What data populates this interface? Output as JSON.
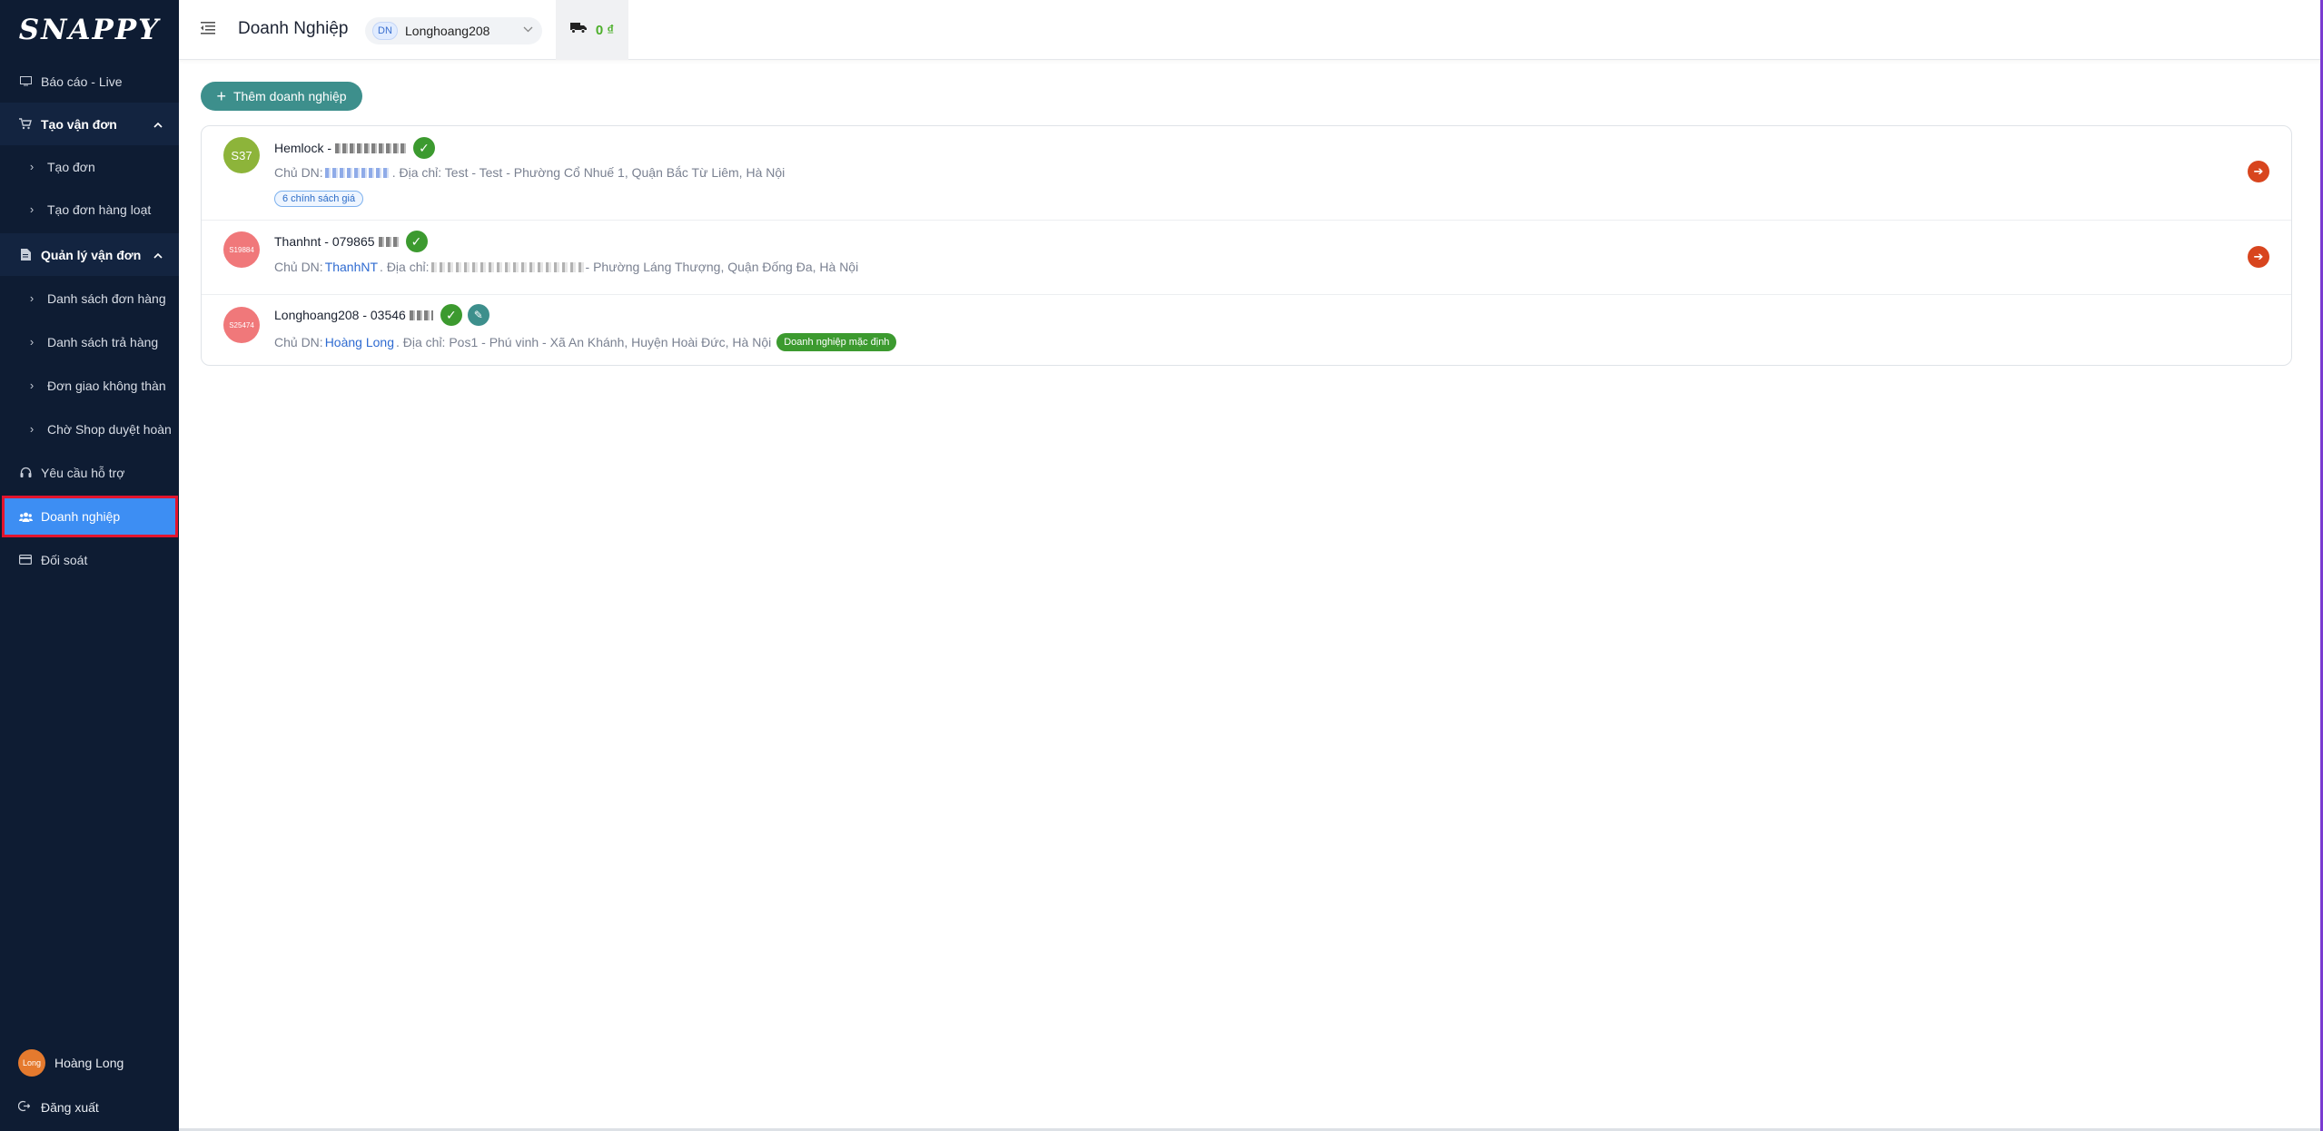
{
  "brand": {
    "logo_text": "SNAPPY"
  },
  "sidebar": {
    "items": [
      {
        "label": "Báo cáo - Live",
        "icon": "monitor-icon"
      },
      {
        "label": "Tạo vận đơn",
        "icon": "cart-icon",
        "group": true
      },
      {
        "label": "Tạo đơn",
        "icon": "chevron-right-icon"
      },
      {
        "label": "Tạo đơn hàng loạt",
        "icon": "chevron-right-icon"
      },
      {
        "label": "Quản lý vận đơn",
        "icon": "document-icon",
        "group": true
      },
      {
        "label": "Danh sách đơn hàng",
        "icon": "chevron-right-icon"
      },
      {
        "label": "Danh sách trả hàng",
        "icon": "chevron-right-icon"
      },
      {
        "label": "Đơn giao không thàn",
        "icon": "chevron-right-icon"
      },
      {
        "label": "Chờ Shop duyệt hoàn",
        "icon": "chevron-right-icon"
      },
      {
        "label": "Yêu cầu hỗ trợ",
        "icon": "headset-icon"
      },
      {
        "label": "Doanh nghiệp",
        "icon": "users-icon",
        "active": true
      },
      {
        "label": "Đối soát",
        "icon": "card-icon"
      }
    ],
    "user": {
      "avatar_text": "Long",
      "name": "Hoàng Long"
    },
    "logout_label": "Đăng xuất"
  },
  "header": {
    "title": "Doanh Nghiệp",
    "business_select": {
      "chip": "DN",
      "value": "Longhoang208"
    },
    "balance": "0 ₫"
  },
  "main": {
    "add_button_label": "Thêm doanh nghiệp",
    "businesses": [
      {
        "avatar": "S37",
        "avatar_color": "#8db43a",
        "name": "Hemlock - ",
        "owner_prefix": "Chủ DN: ",
        "owner": "",
        "address": ". Địa chỉ: Test - Test - Phường Cổ Nhuế 1, Quận Bắc Từ Liêm, Hà Nội",
        "policy_tag": "6 chính sách giá",
        "verified": true
      },
      {
        "avatar": "S19884",
        "avatar_color": "#f0787a",
        "name": "Thanhnt - 079865",
        "owner_prefix": "Chủ DN: ",
        "owner": "ThanhNT",
        "address_prefix": ". Địa chỉ: ",
        "address": " - Phường Láng Thượng, Quận Đống Đa, Hà Nội",
        "verified": true
      },
      {
        "avatar": "S25474",
        "avatar_color": "#f0787a",
        "name": "Longhoang208 - 03546",
        "owner_prefix": "Chủ DN: ",
        "owner": "Hoàng Long",
        "address": ". Địa chỉ: Pos1 - Phú vinh - Xã An Khánh, Huyện Hoài Đức, Hà Nội",
        "default_tag": "Doanh nghiệp mặc định",
        "verified": true
      }
    ]
  },
  "colors": {
    "sidebar_bg": "#0e1c33",
    "active": "#3d8ef3",
    "highlight": "#e3142d",
    "teal": "#3d8f8c",
    "success": "#3c9a2f",
    "action": "#d8451e"
  }
}
